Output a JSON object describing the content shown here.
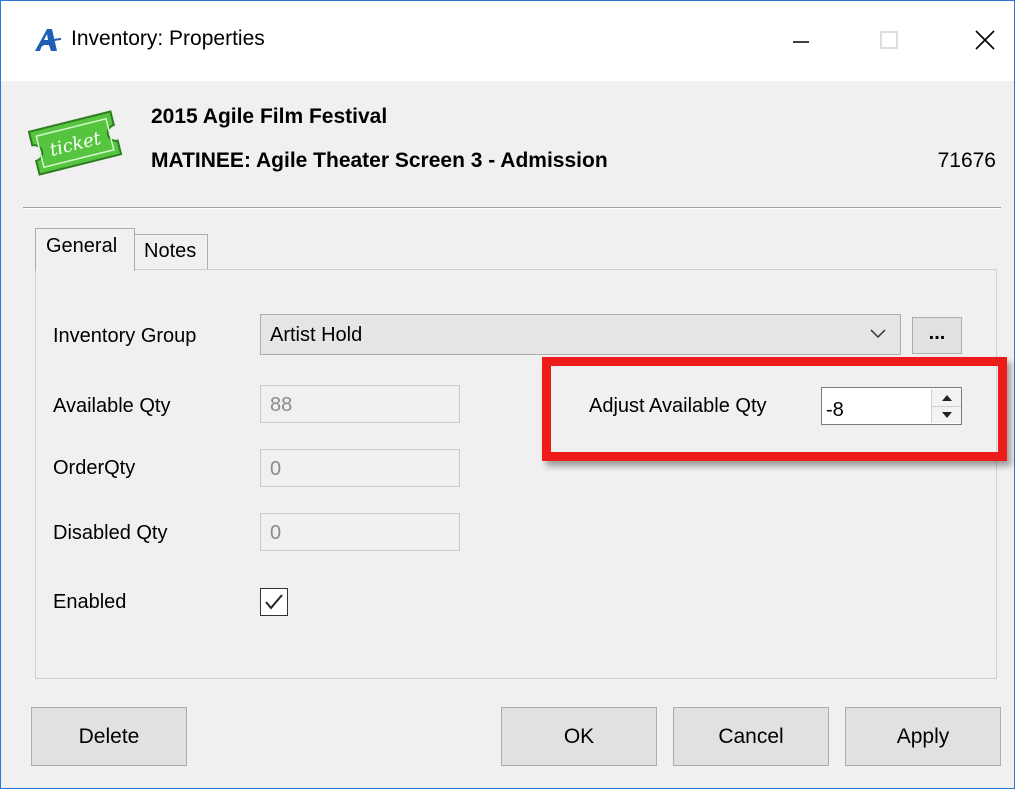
{
  "window": {
    "title": "Inventory: Properties",
    "controls": {
      "minimize": "minimize",
      "maximize": "maximize",
      "close": "close"
    }
  },
  "header": {
    "event_name": "2015 Agile Film Festival",
    "performance_name": "MATINEE: Agile Theater Screen 3 - Admission",
    "item_code": "71676",
    "icon_text": "ticket"
  },
  "tabs": [
    {
      "label": "General",
      "selected": true
    },
    {
      "label": "Notes",
      "selected": false
    }
  ],
  "form": {
    "inventory_group": {
      "label": "Inventory Group",
      "value": "Artist Hold",
      "browse_label": "..."
    },
    "available_qty": {
      "label": "Available Qty",
      "value": "88"
    },
    "adjust_available_qty": {
      "label": "Adjust Available Qty",
      "value": "-8"
    },
    "order_qty": {
      "label": "OrderQty",
      "value": "0"
    },
    "disabled_qty": {
      "label": "Disabled Qty",
      "value": "0"
    },
    "enabled": {
      "label": "Enabled",
      "checked": true
    }
  },
  "buttons": {
    "delete": "Delete",
    "ok": "OK",
    "cancel": "Cancel",
    "apply": "Apply"
  },
  "colors": {
    "highlight_border": "#ee1b1b",
    "app_icon_blue": "#1f5fb5",
    "ticket_green": "#55c43f"
  }
}
